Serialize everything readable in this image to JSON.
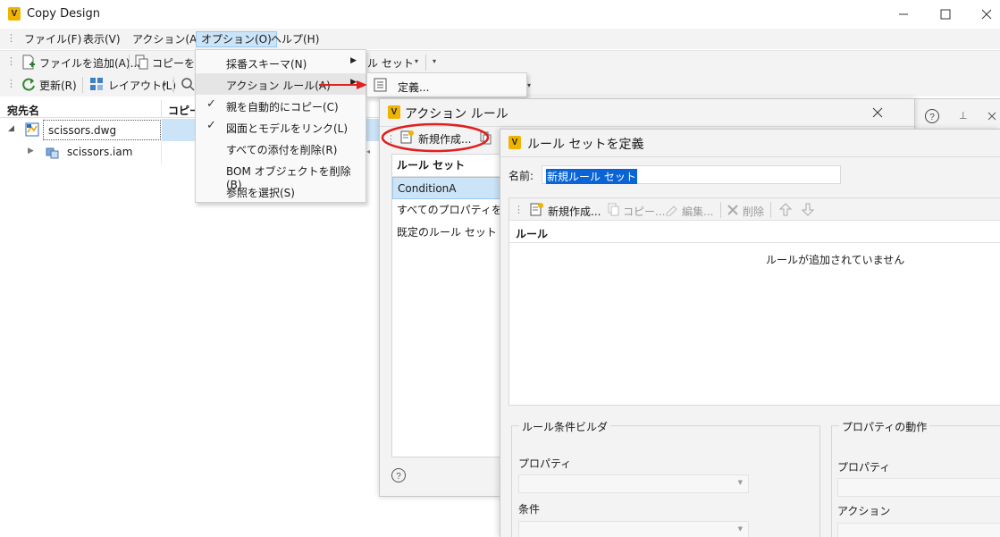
{
  "window": {
    "title": "Copy Design",
    "logo_letter": "V"
  },
  "menubar": {
    "items": [
      "ファイル(F)",
      "表示(V)",
      "アクション(A)",
      "オプション(O)",
      "ヘルプ(H)"
    ]
  },
  "toolbar1": {
    "add_file": "ファイルを追加(A)...",
    "copy_partial": "コピーを実",
    "ruleset_partial": "ル セット"
  },
  "toolbar2": {
    "refresh": "更新(R)",
    "layout": "レイアウト(L)"
  },
  "grid": {
    "headers": [
      "宛先名",
      "コピー"
    ],
    "rows": [
      {
        "name": "scissors.dwg",
        "icon": "drawing-icon",
        "expanded": true
      },
      {
        "name": "scissors.iam",
        "icon": "assembly-icon",
        "expanded": false
      }
    ]
  },
  "options_menu": {
    "items": [
      {
        "label": "採番スキーマ(N)",
        "submenu": true,
        "checked": false
      },
      {
        "label": "アクション ルール(A)",
        "submenu": true,
        "checked": false,
        "highlighted": true
      },
      {
        "label": "親を自動的にコピー(C)",
        "submenu": false,
        "checked": true
      },
      {
        "label": "図面とモデルをリンク(L)",
        "submenu": false,
        "checked": true
      },
      {
        "label": "すべての添付を削除(R)",
        "submenu": false,
        "checked": false
      },
      {
        "label": "BOM オブジェクトを削除(B)",
        "submenu": false,
        "checked": false
      },
      {
        "label": "参照を選択(S)",
        "submenu": false,
        "checked": false
      }
    ]
  },
  "submenu": {
    "define": "定義..."
  },
  "action_dialog": {
    "title": "アクション ルール",
    "new_button": "新規作成...",
    "list_header": "ルール セット",
    "rulesets": [
      "ConditionA",
      "すべてのプロパティをコピー",
      "既定のルール セット"
    ]
  },
  "define_dialog": {
    "title": "ルール セットを定義",
    "name_label": "名前:",
    "name_value": "新規ルール セット",
    "toolbar": {
      "new": "新規作成...",
      "copy": "コピー...",
      "edit": "編集...",
      "delete": "削除"
    },
    "rules_header": "ルール",
    "empty_message": "ルールが追加されていません",
    "condition_builder": {
      "title": "ルール条件ビルダ",
      "property_label": "プロパティ",
      "condition_label": "条件"
    },
    "property_actions": {
      "title": "プロパティの動作",
      "property_label": "プロパティ",
      "action_label": "アクション"
    }
  },
  "colors": {
    "accent_red": "#e02020",
    "selection": "#cce4f7",
    "name_highlight": "#0a64d6",
    "logo_yellow": "#f0b400"
  }
}
